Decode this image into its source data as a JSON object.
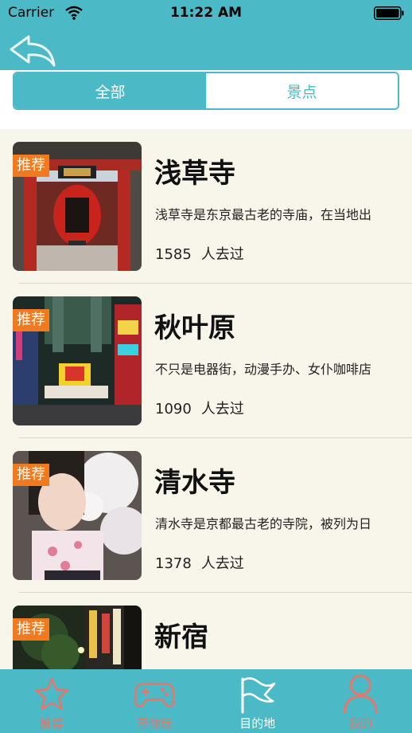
{
  "status_bar": {
    "carrier": "Carrier",
    "time": "11:22 AM"
  },
  "segments": [
    {
      "label": "全部",
      "active": true
    },
    {
      "label": "景点",
      "active": false
    }
  ],
  "places": [
    {
      "tag": "推荐",
      "title": "浅草寺",
      "desc": "浅草寺是东京最古老的寺庙，在当地出",
      "visits": "1585",
      "visits_suffix": "人去过"
    },
    {
      "tag": "推荐",
      "title": "秋叶原",
      "desc": "不只是电器街，动漫手办、女仆咖啡店",
      "visits": "1090",
      "visits_suffix": "人去过"
    },
    {
      "tag": "推荐",
      "title": "清水寺",
      "desc": "清水寺是京都最古老的寺院，被列为日",
      "visits": "1378",
      "visits_suffix": "人去过"
    },
    {
      "tag": "推荐",
      "title": "新宿",
      "desc": "",
      "visits": "",
      "visits_suffix": ""
    }
  ],
  "tabbar": [
    {
      "label": "推荐",
      "icon": "star-icon",
      "active": false
    },
    {
      "label": "带你玩",
      "icon": "gamepad-icon",
      "active": false
    },
    {
      "label": "目的地",
      "icon": "flag-icon",
      "active": true
    },
    {
      "label": "我的",
      "icon": "person-icon",
      "active": false
    }
  ],
  "colors": {
    "accent": "#4cb9c6",
    "tag": "#f07a1f",
    "inactive_tab": "#e3786c",
    "list_bg": "#f8f5ea"
  }
}
